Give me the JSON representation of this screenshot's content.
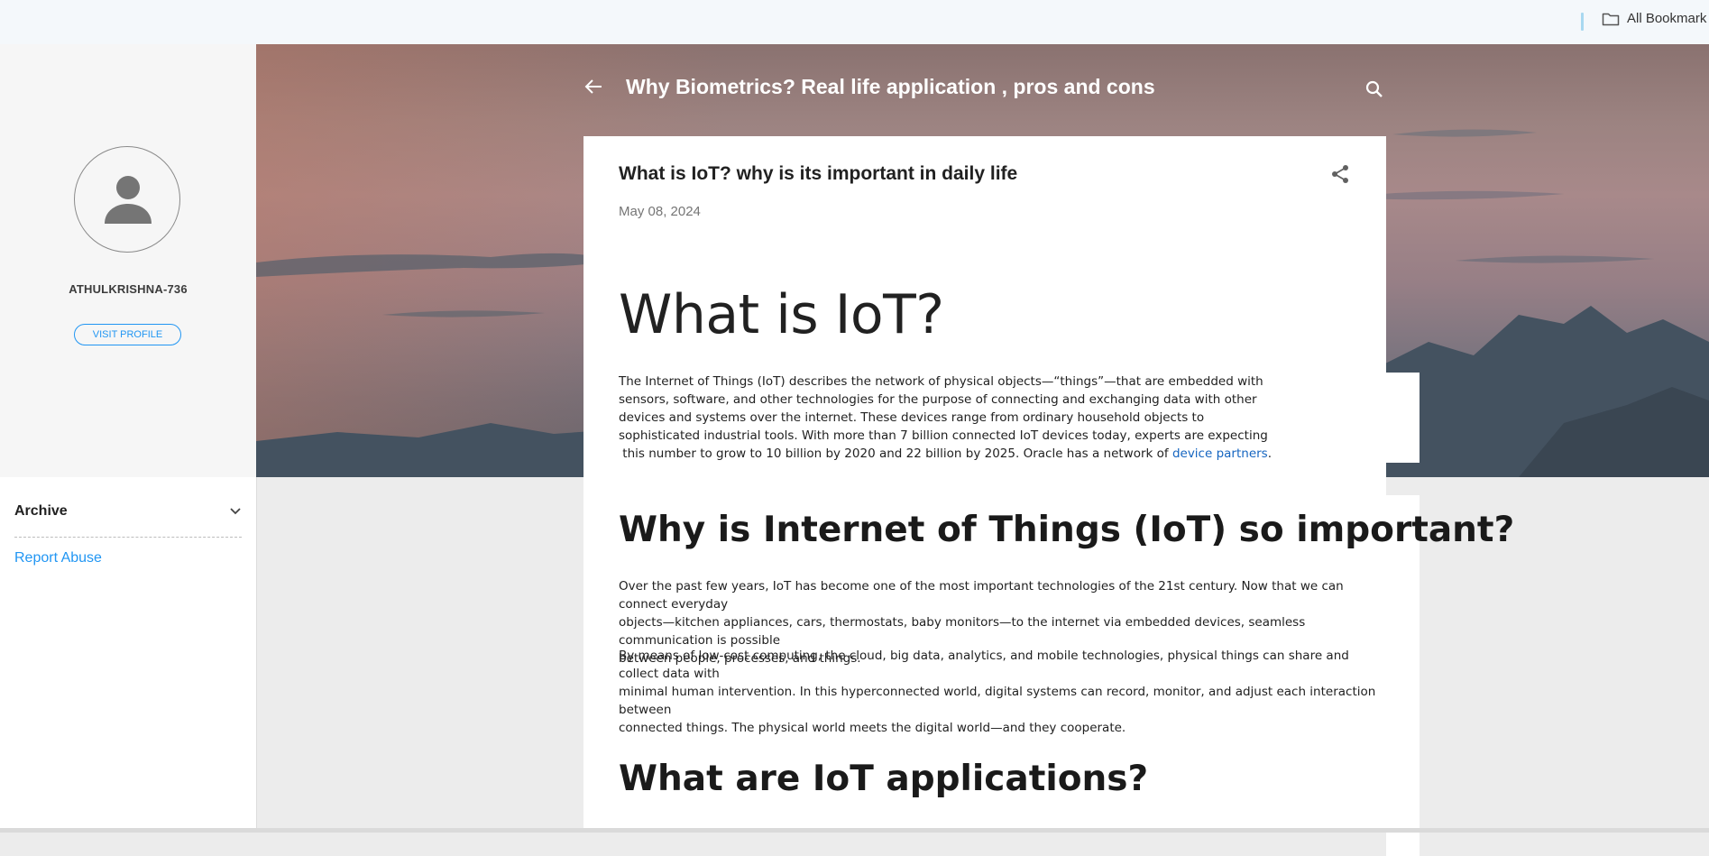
{
  "bookmarks_bar": {
    "all_bookmarks_label": "All Bookmark",
    "folder_icon": "folder-icon"
  },
  "sidebar": {
    "username": "ATHULKRISHNA-736",
    "visit_profile_label": "VISIT PROFILE",
    "archive_label": "Archive",
    "report_abuse_label": "Report Abuse",
    "avatar_icon": "person-icon"
  },
  "header": {
    "blog_title": "Why Biometrics? Real life application , pros and cons",
    "back_icon": "arrow-back-icon",
    "search_icon": "search-icon"
  },
  "post": {
    "title": "What is IoT? why is its important in daily life",
    "date": "May 08, 2024",
    "share_icon": "share-icon",
    "heading_1": "What is IoT?",
    "para_1": {
      "lines": [
        "The Internet of Things (IoT) describes the network of physical objects—“things”—that are embedded with",
        "sensors, software, and other technologies for the purpose of connecting and exchanging data with other",
        "devices and systems over the internet. These devices range from ordinary household objects to",
        "sophisticated industrial tools. With more than 7 billion connected IoT devices today, experts are expecting"
      ],
      "last_line_before_link": " this number to grow to 10 billion by 2020 and 22 billion by 2025. Oracle has a network of ",
      "link_text": "device partners",
      "last_line_after_link": "."
    },
    "heading_2": "Why is Internet of Things (IoT) so important?",
    "para_2": {
      "lines": [
        "Over the past few years, IoT has become one of the most important technologies of the 21st century. Now that we can connect everyday",
        "objects—kitchen appliances, cars, thermostats, baby monitors—to the internet via embedded devices, seamless communication is possible",
        "between people, processes, and things."
      ]
    },
    "para_3": {
      "lines": [
        "By means of low-cost computing, the cloud, big data, analytics, and mobile technologies, physical things can share and collect data with",
        "minimal human intervention. In this hyperconnected world, digital systems can record, monitor, and adjust each interaction between",
        "connected things. The physical world meets the digital world—and they cooperate."
      ]
    },
    "heading_3": "What are IoT applications?"
  },
  "colors": {
    "accent": "#2196f3",
    "link": "#1565c0",
    "hero_sky": "#a8898a",
    "page_bg": "#ececec"
  }
}
